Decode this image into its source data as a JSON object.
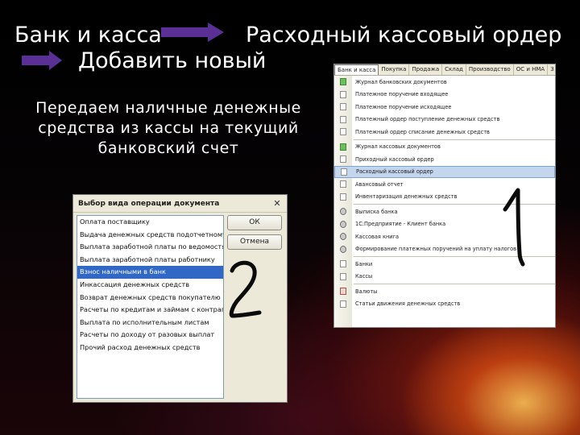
{
  "slide": {
    "path_start": "Банк и касса",
    "path_end": "Расходный кассовый ордер",
    "path_next": "Добавить новый",
    "description": "Передаем наличные денежные средства из кассы на текущий банковский счет"
  },
  "dialog": {
    "title": "Выбор вида операции документа",
    "close_glyph": "✕",
    "ok_label": "ОК",
    "cancel_label": "Отмена",
    "items": [
      "Оплата поставщику",
      "Выдача денежных средств подотчетному лицу",
      "Выплата заработной платы по ведомостям",
      "Выплата заработной платы работнику",
      "Взнос наличными в банк",
      "Инкассация денежных средств",
      "Возврат денежных средств покупателю",
      "Расчеты по кредитам и займам с контрагентами",
      "Выплата по исполнительным листам",
      "Расчеты по доходу от разовых выплат",
      "Прочий расход денежных средств"
    ],
    "selected_index": 4
  },
  "menu": {
    "bar": [
      "Банк и касса",
      "Покупка",
      "Продажа",
      "Склад",
      "Производство",
      "ОС и НМА",
      "З"
    ],
    "items": [
      {
        "label": "Журнал банковских документов",
        "icon": "green"
      },
      {
        "label": "Платежное поручение входящее",
        "icon": "doc"
      },
      {
        "label": "Платежное поручение исходящее",
        "icon": "doc"
      },
      {
        "label": "Платежный ордер поступление денежных средств",
        "icon": "doc"
      },
      {
        "label": "Платежный ордер списание денежных средств",
        "icon": "doc"
      },
      {
        "label": "Журнал кассовых документов",
        "icon": "green"
      },
      {
        "label": "Приходный кассовый ордер",
        "icon": "doc"
      },
      {
        "label": "Расходный кассовый ордер",
        "icon": "doc"
      },
      {
        "label": "Авансовый отчет",
        "icon": "doc"
      },
      {
        "label": "Инвентаризация денежных средств",
        "icon": "doc"
      },
      {
        "label": "Выписка банка",
        "icon": "gear"
      },
      {
        "label": "1С:Предприятие - Клиент банка",
        "icon": "gear"
      },
      {
        "label": "Кассовая книга",
        "icon": "gear"
      },
      {
        "label": "Формирование платежных поручений на уплату налогов",
        "icon": "gear"
      },
      {
        "label": "Банки",
        "icon": "doc"
      },
      {
        "label": "Кассы",
        "icon": "doc"
      },
      {
        "label": "Валюты",
        "icon": "red"
      },
      {
        "label": "Статьи движения денежных средств",
        "icon": "doc"
      }
    ],
    "highlight_index": 7
  },
  "annotations": {
    "menu_step": "1",
    "dialog_step": "2"
  },
  "colors": {
    "arrow": "#5b3096",
    "selection": "#3168c6",
    "menu_highlight": "#c4d6ee"
  }
}
